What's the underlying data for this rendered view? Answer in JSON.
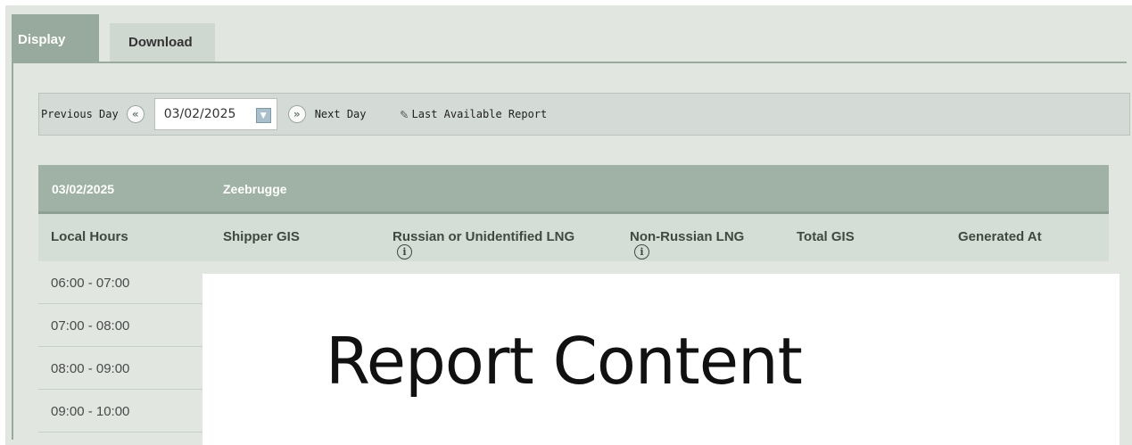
{
  "tabs": [
    {
      "label": "Display",
      "active": true
    },
    {
      "label": "Download",
      "active": false
    }
  ],
  "date_nav": {
    "previous_label": "Previous Day",
    "date_value": "03/02/2025",
    "next_label": "Next Day",
    "last_report_label": "Last Available Report"
  },
  "report_header": {
    "date": "03/02/2025",
    "location": "Zeebrugge"
  },
  "table": {
    "columns": [
      "Local Hours",
      "Shipper GIS",
      "Russian or Unidentified LNG",
      "Non-Russian LNG",
      "Total GIS",
      "Generated At"
    ],
    "rows": [
      "06:00 - 07:00",
      "07:00 - 08:00",
      "08:00 - 09:00",
      "09:00 - 10:00"
    ]
  },
  "overlay": {
    "text": "Report Content"
  },
  "colors": {
    "active_tab": "#97aa9d",
    "header_band": "#9fb2a5",
    "column_header": "#d5ddd7",
    "background": "#e1e6e1"
  },
  "icons": {
    "prev": "chevron-double-left-icon",
    "next": "chevron-double-right-icon",
    "calendar": "calendar-dropdown-icon",
    "report": "pencil-report-icon",
    "info": "info-circle-icon"
  }
}
